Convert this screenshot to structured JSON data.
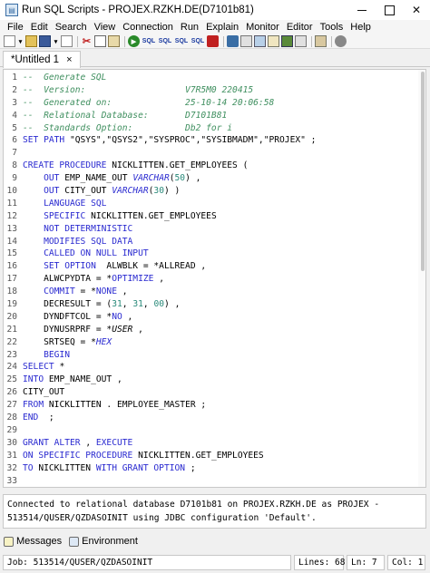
{
  "window": {
    "title": "Run SQL Scripts - PROJEX.RZKH.DE(D7101b81)"
  },
  "menu": [
    "File",
    "Edit",
    "Search",
    "View",
    "Connection",
    "Run",
    "Explain",
    "Monitor",
    "Editor",
    "Tools",
    "Help"
  ],
  "toolbar": {
    "sql_labels": [
      "SQL",
      "SQL",
      "SQL",
      "SQL"
    ]
  },
  "tab": {
    "label": "*Untitled 1",
    "close": "×"
  },
  "editor": {
    "lines": [
      {
        "n": "1",
        "segs": [
          {
            "c": "cm",
            "t": "--  Generate SQL"
          }
        ]
      },
      {
        "n": "2",
        "segs": [
          {
            "c": "cm",
            "t": "--  Version:                   V7R5M0 220415"
          }
        ]
      },
      {
        "n": "3",
        "segs": [
          {
            "c": "cm",
            "t": "--  Generated on:              25-10-14 20:06:58"
          }
        ]
      },
      {
        "n": "4",
        "segs": [
          {
            "c": "cm",
            "t": "--  Relational Database:       D7101B81"
          }
        ]
      },
      {
        "n": "5",
        "segs": [
          {
            "c": "cm",
            "t": "--  Standards Option:          Db2 for i"
          }
        ]
      },
      {
        "n": "6",
        "segs": [
          {
            "c": "kw",
            "t": "SET PATH "
          },
          {
            "c": "",
            "t": "\"QSYS\",\"QSYS2\",\"SYSPROC\",\"SYSIBMADM\",\"PROJEX\" ;"
          }
        ]
      },
      {
        "n": "7",
        "segs": []
      },
      {
        "n": "8",
        "segs": [
          {
            "c": "kw",
            "t": "CREATE PROCEDURE "
          },
          {
            "c": "",
            "t": "NICKLITTEN.GET_EMPLOYEES ("
          }
        ]
      },
      {
        "n": "9",
        "segs": [
          {
            "c": "kw",
            "t": "    OUT "
          },
          {
            "c": "",
            "t": "EMP_NAME_OUT "
          },
          {
            "c": "kw it",
            "t": "VARCHAR"
          },
          {
            "c": "",
            "t": "("
          },
          {
            "c": "nm",
            "t": "50"
          },
          {
            "c": "",
            "t": ") ,"
          }
        ]
      },
      {
        "n": "10",
        "segs": [
          {
            "c": "kw",
            "t": "    OUT "
          },
          {
            "c": "",
            "t": "CITY_OUT "
          },
          {
            "c": "kw it",
            "t": "VARCHAR"
          },
          {
            "c": "",
            "t": "("
          },
          {
            "c": "nm",
            "t": "30"
          },
          {
            "c": "",
            "t": ") )"
          }
        ]
      },
      {
        "n": "11",
        "segs": [
          {
            "c": "kw",
            "t": "    LANGUAGE SQL"
          }
        ]
      },
      {
        "n": "12",
        "segs": [
          {
            "c": "kw",
            "t": "    SPECIFIC "
          },
          {
            "c": "",
            "t": "NICKLITTEN.GET_EMPLOYEES"
          }
        ]
      },
      {
        "n": "13",
        "segs": [
          {
            "c": "kw",
            "t": "    NOT DETERMINISTIC"
          }
        ]
      },
      {
        "n": "14",
        "segs": [
          {
            "c": "kw",
            "t": "    MODIFIES SQL DATA"
          }
        ]
      },
      {
        "n": "15",
        "segs": [
          {
            "c": "kw",
            "t": "    CALLED ON NULL INPUT"
          }
        ]
      },
      {
        "n": "16",
        "segs": [
          {
            "c": "kw",
            "t": "    SET OPTION  "
          },
          {
            "c": "",
            "t": "ALWBLK = *ALLREAD ,"
          }
        ]
      },
      {
        "n": "17",
        "segs": [
          {
            "c": "",
            "t": "    ALWCPYDTA = *"
          },
          {
            "c": "kw",
            "t": "OPTIMIZE"
          },
          {
            "c": "",
            "t": " ,"
          }
        ]
      },
      {
        "n": "18",
        "segs": [
          {
            "c": "kw",
            "t": "    COMMIT"
          },
          {
            "c": "",
            "t": " = *"
          },
          {
            "c": "kw",
            "t": "NONE"
          },
          {
            "c": "",
            "t": " ,"
          }
        ]
      },
      {
        "n": "19",
        "segs": [
          {
            "c": "",
            "t": "    DECRESULT = ("
          },
          {
            "c": "nm",
            "t": "31"
          },
          {
            "c": "",
            "t": ", "
          },
          {
            "c": "nm",
            "t": "31"
          },
          {
            "c": "",
            "t": ", "
          },
          {
            "c": "nm",
            "t": "00"
          },
          {
            "c": "",
            "t": ") ,"
          }
        ]
      },
      {
        "n": "20",
        "segs": [
          {
            "c": "",
            "t": "    DYNDFTCOL = *"
          },
          {
            "c": "kw",
            "t": "NO"
          },
          {
            "c": "",
            "t": " ,"
          }
        ]
      },
      {
        "n": "21",
        "segs": [
          {
            "c": "",
            "t": "    DYNUSRPRF = *"
          },
          {
            "c": "it",
            "t": "USER"
          },
          {
            "c": "",
            "t": " ,"
          }
        ]
      },
      {
        "n": "22",
        "segs": [
          {
            "c": "",
            "t": "    SRTSEQ = *"
          },
          {
            "c": "kw it",
            "t": "HEX"
          }
        ]
      },
      {
        "n": "23",
        "segs": [
          {
            "c": "kw",
            "t": "    BEGIN"
          }
        ]
      },
      {
        "n": "24",
        "segs": [
          {
            "c": "kw",
            "t": "SELECT "
          },
          {
            "c": "",
            "t": "*"
          }
        ]
      },
      {
        "n": "25",
        "segs": [
          {
            "c": "kw",
            "t": "INTO "
          },
          {
            "c": "",
            "t": "EMP_NAME_OUT ,"
          }
        ]
      },
      {
        "n": "26",
        "segs": [
          {
            "c": "",
            "t": "CITY_OUT"
          }
        ]
      },
      {
        "n": "27",
        "segs": [
          {
            "c": "kw",
            "t": "FROM "
          },
          {
            "c": "",
            "t": "NICKLITTEN . EMPLOYEE_MASTER ;"
          }
        ]
      },
      {
        "n": "28",
        "segs": [
          {
            "c": "kw",
            "t": "END "
          },
          {
            "c": "",
            "t": " ;"
          }
        ]
      },
      {
        "n": "29",
        "segs": []
      },
      {
        "n": "30",
        "segs": [
          {
            "c": "kw",
            "t": "GRANT ALTER "
          },
          {
            "c": "",
            "t": ", "
          },
          {
            "c": "kw",
            "t": "EXECUTE"
          }
        ]
      },
      {
        "n": "31",
        "segs": [
          {
            "c": "kw",
            "t": "ON SPECIFIC PROCEDURE "
          },
          {
            "c": "",
            "t": "NICKLITTEN.GET_EMPLOYEES"
          }
        ]
      },
      {
        "n": "32",
        "segs": [
          {
            "c": "kw",
            "t": "TO "
          },
          {
            "c": "",
            "t": "NICKLITTEN "
          },
          {
            "c": "kw",
            "t": "WITH GRANT OPTION"
          },
          {
            "c": "",
            "t": " ;"
          }
        ]
      },
      {
        "n": "33",
        "segs": []
      }
    ]
  },
  "console": {
    "line1": "Connected to relational database D7101b81 on PROJEX.RZKH.DE as PROJEX -",
    "line2": "513514/QUSER/QZDASOINIT using JDBC configuration 'Default'."
  },
  "views": {
    "messages": "Messages",
    "environment": "Environment"
  },
  "status": {
    "job": "Job: 513514/QUSER/QZDASOINIT",
    "lines": "Lines: 68",
    "ln": "Ln: 7",
    "col": "Col: 1"
  }
}
